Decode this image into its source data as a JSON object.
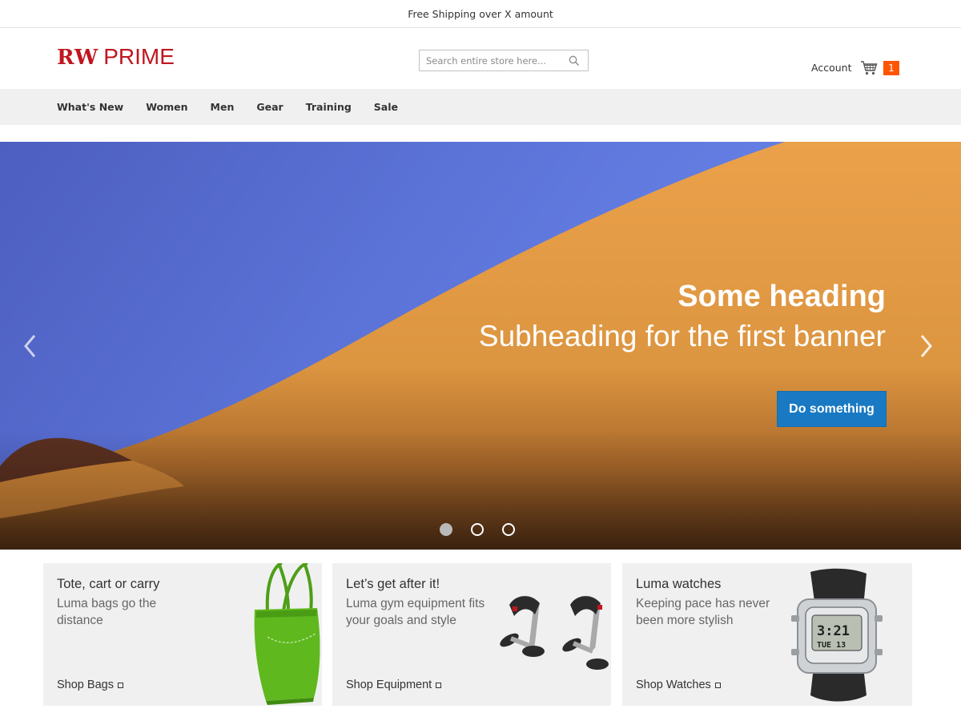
{
  "promo_bar": {
    "text": "Free Shipping over X amount"
  },
  "header": {
    "logo_part1": "RW",
    "logo_part2": "PRIME",
    "search_placeholder": "Search entire store here...",
    "account_label": "Account",
    "cart_count": "1"
  },
  "nav": {
    "items": [
      {
        "label": "What's New"
      },
      {
        "label": "Women"
      },
      {
        "label": "Men"
      },
      {
        "label": "Gear"
      },
      {
        "label": "Training"
      },
      {
        "label": "Sale"
      }
    ]
  },
  "hero": {
    "heading": "Some heading",
    "subheading": "Subheading for the first banner",
    "button_label": "Do something",
    "active_slide": 1,
    "slide_count": 3,
    "colors": {
      "sky": "#5f78dc",
      "sand": "#e49a45",
      "button": "#1979c3"
    }
  },
  "tiles": [
    {
      "title": "Tote, cart or carry",
      "subtitle": "Luma bags go the distance",
      "link": "Shop Bags",
      "icon": "green-tote-bag"
    },
    {
      "title": "Let’s get after it!",
      "subtitle": "Luma gym equipment fits your goals and style",
      "link": "Shop Equipment",
      "icon": "pushup-bars"
    },
    {
      "title": "Luma watches",
      "subtitle": "Keeping pace has never been more stylish",
      "link": "Shop Watches",
      "icon": "digital-watch"
    }
  ],
  "watch_display": {
    "time": "3:21",
    "day": "TUE 13"
  }
}
